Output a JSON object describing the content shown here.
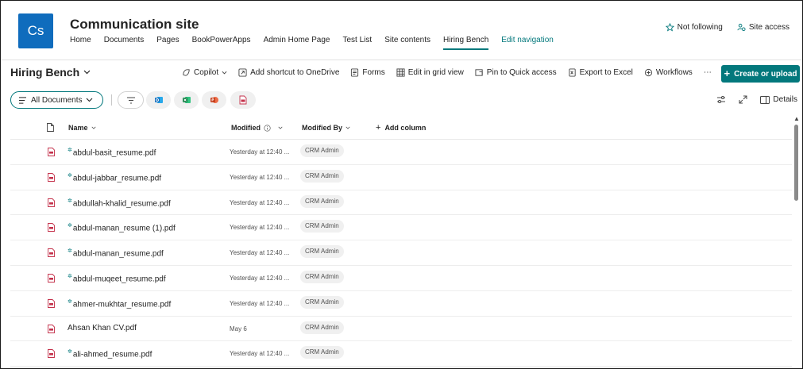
{
  "site": {
    "logo_initials": "Cs",
    "title": "Communication site",
    "nav": [
      "Home",
      "Documents",
      "Pages",
      "BookPowerApps",
      "Admin Home Page",
      "Test List",
      "Site contents",
      "Hiring Bench"
    ],
    "edit_nav": "Edit navigation",
    "not_following": "Not following",
    "site_access": "Site access"
  },
  "commands": {
    "library_title": "Hiring Bench",
    "copilot": "Copilot",
    "add_shortcut": "Add shortcut to OneDrive",
    "forms": "Forms",
    "edit_grid": "Edit in grid view",
    "pin_quick": "Pin to Quick access",
    "export_excel": "Export to Excel",
    "workflows": "Workflows",
    "more": "⋯",
    "create_upload": "Create or upload"
  },
  "view": {
    "all_documents": "All Documents",
    "details": "Details"
  },
  "columns": {
    "name": "Name",
    "modified": "Modified",
    "modified_by": "Modified By",
    "add_column": "Add column"
  },
  "rows": [
    {
      "name": "abdul-basit_resume.pdf",
      "new": true,
      "modified": "Yesterday at 12:40 ...",
      "by": "CRM Admin"
    },
    {
      "name": "abdul-jabbar_resume.pdf",
      "new": true,
      "modified": "Yesterday at 12:40 ...",
      "by": "CRM Admin"
    },
    {
      "name": "abdullah-khalid_resume.pdf",
      "new": true,
      "modified": "Yesterday at 12:40 ...",
      "by": "CRM Admin"
    },
    {
      "name": "abdul-manan_resume (1).pdf",
      "new": true,
      "modified": "Yesterday at 12:40 ...",
      "by": "CRM Admin"
    },
    {
      "name": "abdul-manan_resume.pdf",
      "new": true,
      "modified": "Yesterday at 12:40 ...",
      "by": "CRM Admin"
    },
    {
      "name": "abdul-muqeet_resume.pdf",
      "new": true,
      "modified": "Yesterday at 12:40 ...",
      "by": "CRM Admin"
    },
    {
      "name": "ahmer-mukhtar_resume.pdf",
      "new": true,
      "modified": "Yesterday at 12:40 ...",
      "by": "CRM Admin"
    },
    {
      "name": "Ahsan Khan CV.pdf",
      "new": false,
      "modified": "May 6",
      "by": "CRM Admin"
    },
    {
      "name": "ali-ahmed_resume.pdf",
      "new": true,
      "modified": "Yesterday at 12:40 ...",
      "by": "CRM Admin"
    }
  ],
  "colors": {
    "accent": "#03787c",
    "logo": "#0f6cbd",
    "pdf_red": "#c4314b"
  }
}
